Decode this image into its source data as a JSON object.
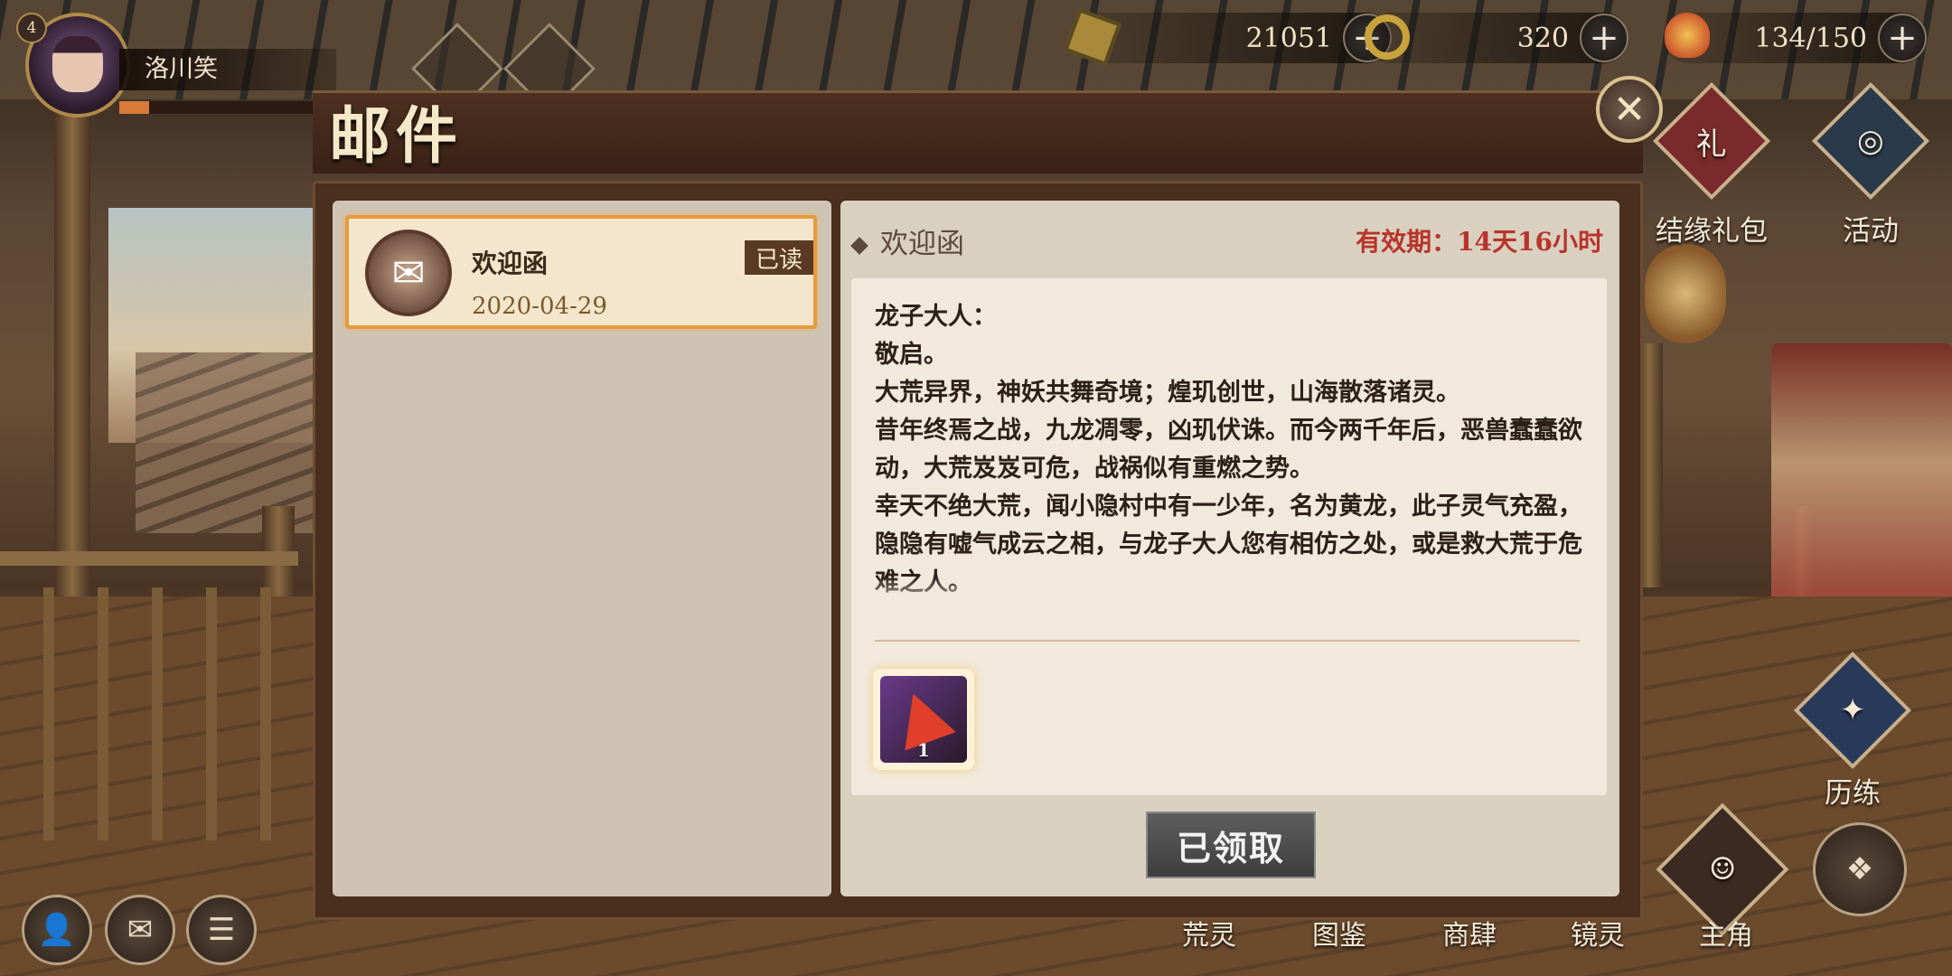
{
  "player": {
    "level": "4",
    "name": "洛川笑",
    "exp_fraction": 0.15
  },
  "resources": [
    {
      "icon": "coin-icon",
      "value": "21051"
    },
    {
      "icon": "ring-token-icon",
      "value": "320"
    },
    {
      "icon": "stamina-icon",
      "value": "134/150"
    }
  ],
  "side_menu": {
    "gift_pack_label": "结缘礼包",
    "events_label": "活动",
    "training_label": "历练"
  },
  "bottom_nav": [
    "荒灵",
    "图鉴",
    "商肆",
    "镜灵",
    "主角"
  ],
  "dialog": {
    "title": "邮件",
    "mail_list": [
      {
        "subject": "欢迎函",
        "date": "2020-04-29",
        "status": "已读"
      }
    ],
    "detail": {
      "subject": "欢迎函",
      "validity": "有效期：14天16小时",
      "body": [
        "龙子大人：",
        "敬启。",
        "大荒异界，神妖共舞奇境；煌玑创世，山海散落诸灵。",
        "昔年终焉之战，九龙凋零，凶玑伏诛。而今两千年后，恶兽蠢蠢欲动，大荒岌岌可危，战祸似有重燃之势。",
        "幸天不绝大荒，闻小隐村中有一少年，名为黄龙，此子灵气充盈，隐隐有嘘气成云之相，与龙子大人您有相仿之处，或是救大荒于危难之人。"
      ],
      "reward": {
        "icon": "red-gem-icon",
        "quantity": "1"
      },
      "claim_button": "已领取"
    }
  },
  "colors": {
    "accent_orange": "#e89a40",
    "validity_red": "#b8342a"
  }
}
